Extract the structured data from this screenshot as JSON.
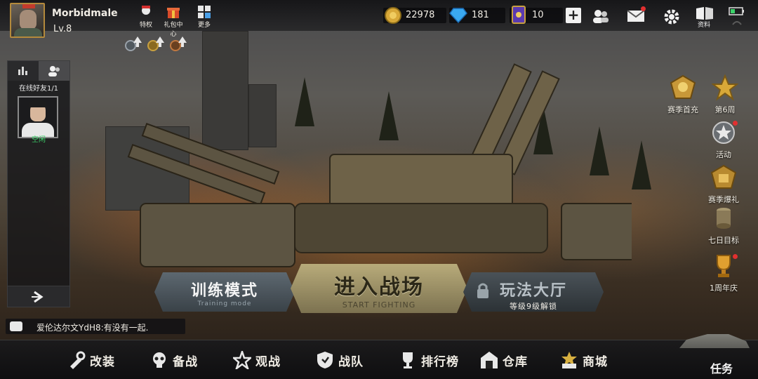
{
  "player": {
    "name": "Morbidmale",
    "level": "Lv.8"
  },
  "top_shortcuts": [
    {
      "label": "特权",
      "icon": "privilege-icon"
    },
    {
      "label": "礼包中心",
      "icon": "gift-icon"
    },
    {
      "label": "更多",
      "icon": "more-grid-icon"
    }
  ],
  "upgrade_badges": [
    "upgrade-badge-1",
    "upgrade-badge-2",
    "upgrade-badge-3"
  ],
  "currencies": {
    "gold": {
      "value": "22978",
      "icon": "gold-coin-icon"
    },
    "diamond": {
      "value": "181",
      "icon": "diamond-icon"
    },
    "card": {
      "value": "10",
      "icon": "card-icon"
    }
  },
  "system_icons": [
    "friends-icon",
    "mail-icon",
    "settings-icon",
    "profile-book-icon",
    "battery-icon"
  ],
  "system_labels": {
    "profile": "资料"
  },
  "friends_panel": {
    "title": "在线好友1/1",
    "friend_status": "空闲"
  },
  "chat": {
    "message": "爱伦达尔文YdH8:有没有一起."
  },
  "events": [
    {
      "label": "赛季首充",
      "icon": "season-recharge-icon",
      "dot": false
    },
    {
      "label": "第6周",
      "icon": "week-star-icon",
      "dot": false
    },
    {
      "label": "活动",
      "icon": "activity-icon",
      "dot": true
    },
    {
      "label": "赛季爆礼",
      "icon": "season-gift-icon",
      "dot": false
    },
    {
      "label": "七日目标",
      "icon": "seven-day-icon",
      "dot": false
    },
    {
      "label": "1周年庆",
      "icon": "anniversary-trophy-icon",
      "dot": true
    }
  ],
  "modes": {
    "training": {
      "label": "训练模式",
      "sub": "Training mode"
    },
    "battle": {
      "label": "进入战场",
      "sub": "START FIGHTING"
    },
    "hall": {
      "label": "玩法大厅",
      "sub": "等级9级解锁"
    }
  },
  "bottom_nav": [
    {
      "label": "改装",
      "icon": "modify-icon"
    },
    {
      "label": "备战",
      "icon": "prepare-skull-icon"
    },
    {
      "label": "观战",
      "icon": "spectate-star-icon"
    },
    {
      "label": "战队",
      "icon": "team-shield-icon"
    },
    {
      "label": "排行榜",
      "icon": "ranking-trophy-icon"
    },
    {
      "label": "仓库",
      "icon": "warehouse-icon"
    },
    {
      "label": "商城",
      "icon": "shop-icon"
    }
  ],
  "task": {
    "label": "任务"
  },
  "colors": {
    "accent_gold": "#b48a3c",
    "online_green": "#3bd36a",
    "alert_red": "#e23030"
  }
}
